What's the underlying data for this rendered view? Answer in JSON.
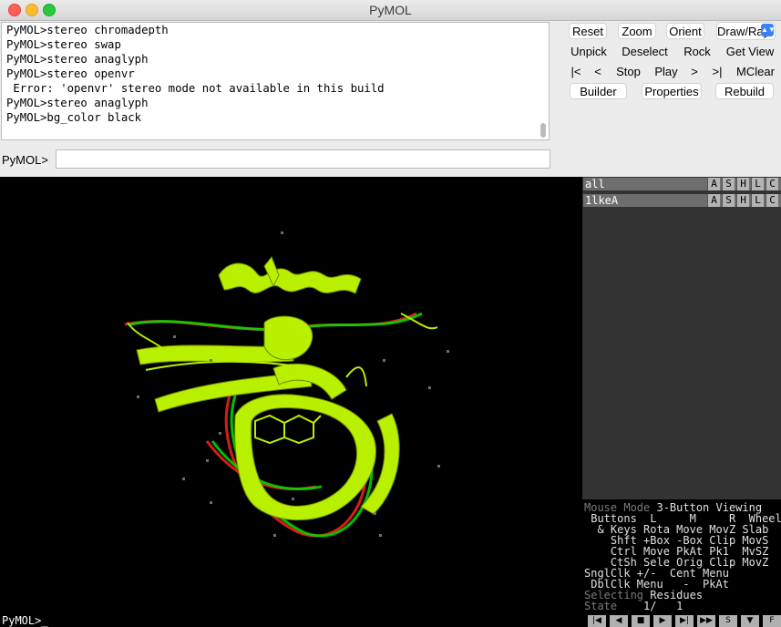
{
  "window": {
    "title": "PyMOL"
  },
  "log": {
    "lines": [
      "PyMOL>stereo chromadepth",
      "PyMOL>stereo swap",
      "PyMOL>stereo anaglyph",
      "PyMOL>stereo openvr",
      " Error: 'openvr' stereo mode not available in this build",
      "PyMOL>stereo anaglyph",
      "PyMOL>bg_color black"
    ]
  },
  "prompt": {
    "label": "PyMOL>",
    "value": ""
  },
  "buttons": {
    "reset": "Reset",
    "zoom": "Zoom",
    "orient": "Orient",
    "draw_ray": "Draw/Ray",
    "unpick": "Unpick",
    "deselect": "Deselect",
    "rock": "Rock",
    "get_view": "Get View",
    "rewind": "|<",
    "back": "<",
    "stop": "Stop",
    "play": "Play",
    "forward": ">",
    "end": ">|",
    "mclear": "MClear",
    "builder": "Builder",
    "properties": "Properties",
    "rebuild": "Rebuild"
  },
  "objects": [
    {
      "name": "all",
      "flags": [
        "A",
        "S",
        "H",
        "L",
        "C"
      ]
    },
    {
      "name": "1lkeA",
      "flags": [
        "A",
        "S",
        "H",
        "L",
        "C"
      ]
    }
  ],
  "mouse_panel": {
    "mode_label": "Mouse Mode",
    "mode_value": "3-Button Viewing",
    "buttons_line": " Buttons  L     M     R  Wheel",
    "keys_line": "  & Keys Rota Move MovZ Slab",
    "shft_line": "    Shft +Box -Box Clip MovS",
    "ctrl_line": "    Ctrl Move PkAt Pk1  MvSZ",
    "ctsh_line": "    CtSh Sele Orig Clip MovZ",
    "snglclk_line": "SnglClk +/-  Cent Menu",
    "dblclk_line": " DblClk Menu   -  PkAt",
    "selecting_label": "Selecting",
    "selecting_value": "Residues",
    "state_label": "State",
    "state_value": "1/   1"
  },
  "cmdline": {
    "text": "PyMOL>_"
  },
  "playbar": {
    "stepper_label": "S",
    "fullscreen_label": "F"
  },
  "colors": {
    "background": "#000000",
    "ribbon": "#b8f000",
    "anaglyph_red": "#ff2020",
    "anaglyph_green": "#00e000",
    "object_row": "#6e6e6e",
    "panel": "#333333"
  },
  "icons": [
    "rewind-icon",
    "step-back-icon",
    "stop-icon",
    "play-icon",
    "step-forward-icon",
    "fast-forward-icon",
    "dropdown-arrow-icon"
  ]
}
